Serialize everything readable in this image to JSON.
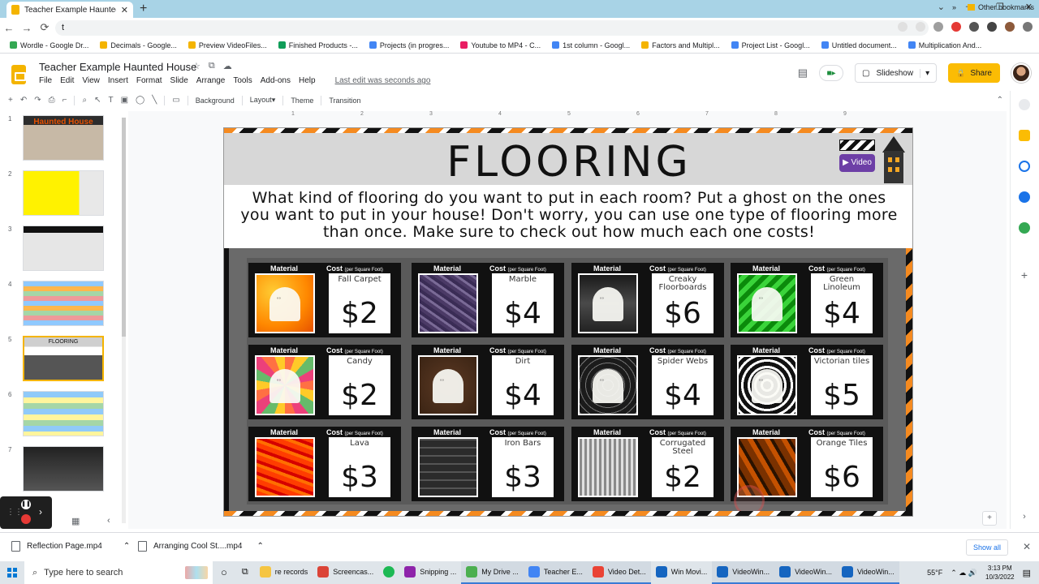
{
  "browser": {
    "tab_title": "Teacher Example Haunted House",
    "tab_close": "✕",
    "new_tab": "+",
    "window_controls": [
      "⌄",
      "—",
      "❐",
      "✕"
    ],
    "address": "t",
    "nav": [
      "←",
      "→",
      "⟳"
    ],
    "bookmarks": [
      {
        "label": "Wordle - Google Dr...",
        "color": "#34a853"
      },
      {
        "label": "Decimals - Google...",
        "color": "#f4b400"
      },
      {
        "label": "Preview VideoFiles...",
        "color": "#f4b400"
      },
      {
        "label": "Finished Products -...",
        "color": "#0f9d58"
      },
      {
        "label": "Projects (in progres...",
        "color": "#4285f4"
      },
      {
        "label": "Youtube to MP4 - C...",
        "color": "#e91e63"
      },
      {
        "label": "1st column - Googl...",
        "color": "#4285f4"
      },
      {
        "label": "Factors and Multipl...",
        "color": "#f4b400"
      },
      {
        "label": "Project List - Googl...",
        "color": "#4285f4"
      },
      {
        "label": "Untitled document...",
        "color": "#4285f4"
      },
      {
        "label": "Multiplication And...",
        "color": "#4285f4"
      }
    ],
    "more_bookmarks": "»",
    "other_bookmarks": "Other bookmarks"
  },
  "app": {
    "doc_title": "Teacher Example Haunted House",
    "title_icons": [
      "☆",
      "⧉",
      "☁"
    ],
    "menus": [
      "File",
      "Edit",
      "View",
      "Insert",
      "Format",
      "Slide",
      "Arrange",
      "Tools",
      "Add-ons",
      "Help"
    ],
    "last_edit": "Last edit was seconds ago",
    "slideshow_label": "Slideshow",
    "share_label": "Share",
    "comment_icon": "▤",
    "meet_icon": "■▸",
    "slideshow_icon": "▢",
    "share_icon": "🔒",
    "dropdown": "▾"
  },
  "toolbar": {
    "add": "+",
    "undo": "↶",
    "redo": "↷",
    "print": "⎙",
    "paint": "⌐",
    "zoom": "⌕",
    "select": "↖",
    "textbox": "T",
    "image": "▣",
    "shape": "◯",
    "line": "╲",
    "comment": "▭",
    "background": "Background",
    "layout": "Layout▾",
    "theme": "Theme",
    "transition": "Transition",
    "collapse": "⌃"
  },
  "ruler": [
    "1",
    "2",
    "3",
    "4",
    "5",
    "6",
    "7",
    "8",
    "9"
  ],
  "filmstrip": {
    "slides": [
      {
        "num": "1",
        "label": "Haunted House"
      },
      {
        "num": "2",
        "label": ""
      },
      {
        "num": "3",
        "label": ""
      },
      {
        "num": "4",
        "label": ""
      },
      {
        "num": "5",
        "label": "FLOORING"
      },
      {
        "num": "6",
        "label": ""
      },
      {
        "num": "7",
        "label": ""
      }
    ]
  },
  "slide": {
    "title": "FLOORING",
    "video_label": "▶ Video",
    "instructions": "What kind of flooring do you want to put in each room? Put a ghost on the ones you want to put in your house! Don't worry, you can use one type of flooring more than once. Make sure to check out how much each one costs!",
    "material_label": "Material",
    "cost_label": "Cost",
    "cost_sub": "(per Square Foot)",
    "items": [
      {
        "name": "Fall Carpet",
        "price": "$2",
        "swatch": "fall",
        "ghost": true
      },
      {
        "name": "Marble",
        "price": "$4",
        "swatch": "marble",
        "ghost": false
      },
      {
        "name": "Creaky Floorboards",
        "price": "$6",
        "swatch": "creaky",
        "ghost": true
      },
      {
        "name": "Green Linoleum",
        "price": "$4",
        "swatch": "green",
        "ghost": true
      },
      {
        "name": "Candy",
        "price": "$2",
        "swatch": "candy",
        "ghost": true
      },
      {
        "name": "Dirt",
        "price": "$4",
        "swatch": "dirt",
        "ghost": true
      },
      {
        "name": "Spider Webs",
        "price": "$4",
        "swatch": "spider",
        "ghost": true
      },
      {
        "name": "Victorian tiles",
        "price": "$5",
        "swatch": "victorian",
        "ghost": true
      },
      {
        "name": "Lava",
        "price": "$3",
        "swatch": "lava",
        "ghost": false
      },
      {
        "name": "Iron Bars",
        "price": "$3",
        "swatch": "iron",
        "ghost": false
      },
      {
        "name": "Corrugated Steel",
        "price": "$2",
        "swatch": "steel",
        "ghost": false
      },
      {
        "name": "Orange Tiles",
        "price": "$6",
        "swatch": "orangetiles",
        "ghost": false
      }
    ]
  },
  "recorder": {
    "pause": "❚❚",
    "arrow": "›",
    "dots": "⋮⋮"
  },
  "filmstrip_controls": {
    "grid": "▦",
    "collapse": "‹"
  },
  "canvas_add": "+",
  "downloads": {
    "files": [
      "Reflection Page.mp4",
      "Arranging Cool St....mp4"
    ],
    "expand": "⌃",
    "show_all": "Show all",
    "close": "✕"
  },
  "taskbar": {
    "search_placeholder": "Type here to search",
    "search_icon": "⌕",
    "cortana": "○",
    "taskview": "⧉",
    "items": [
      {
        "label": "re records",
        "color": "#f5c542",
        "open": false
      },
      {
        "label": "Screencas...",
        "color": "#db4437",
        "open": false
      },
      {
        "label": "",
        "color": "#1db954",
        "open": false
      },
      {
        "label": "Snipping ...",
        "color": "#8e24aa",
        "open": false
      },
      {
        "label": "My Drive ...",
        "color": "#4caf50",
        "open": true
      },
      {
        "label": "Teacher E...",
        "color": "#4285f4",
        "open": true
      },
      {
        "label": "Video Det...",
        "color": "#ea4335",
        "open": true
      },
      {
        "label": "Win Movi...",
        "color": "#1565c0",
        "open": false
      },
      {
        "label": "VideoWin...",
        "color": "#1565c0",
        "open": true
      },
      {
        "label": "VideoWin...",
        "color": "#1565c0",
        "open": true
      },
      {
        "label": "VideoWin...",
        "color": "#1565c0",
        "open": true
      }
    ],
    "weather": "55°F",
    "time": "3:13 PM",
    "date": "10/3/2022",
    "tray_icons": "⌃ ☁ 🔊",
    "notifications": "▤"
  }
}
